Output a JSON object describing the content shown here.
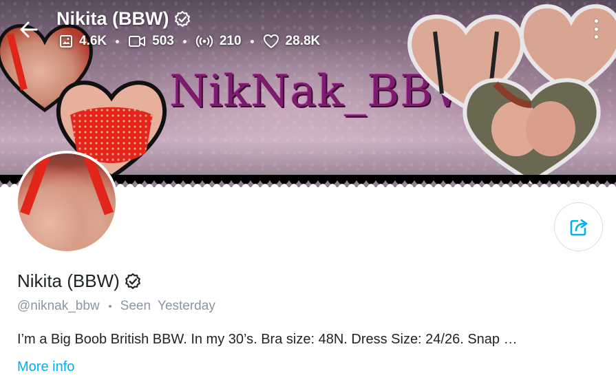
{
  "header": {
    "title": "Nikita (BBW)",
    "stats": {
      "photos": "4.6K",
      "videos": "503",
      "streams": "210",
      "likes": "28.8K"
    }
  },
  "cover": {
    "wordmark": "NikNak_BBW"
  },
  "profile": {
    "name": "Nikita (BBW)",
    "username": "@niknak_bbw",
    "seen_label": "Seen",
    "seen_value": "Yesterday",
    "bio": "I’m a Big Boob British BBW. In my 30’s. Bra size: 48N. Dress Size: 24/26. Snap …",
    "more_info": "More info"
  },
  "colors": {
    "accent": "#00aff0",
    "text_primary": "#1e2326",
    "text_muted": "#8a96a3"
  },
  "icons": [
    "back-arrow-icon",
    "verified-badge-icon",
    "image-icon",
    "video-icon",
    "stream-icon",
    "heart-icon",
    "more-vertical-icon",
    "share-icon"
  ]
}
